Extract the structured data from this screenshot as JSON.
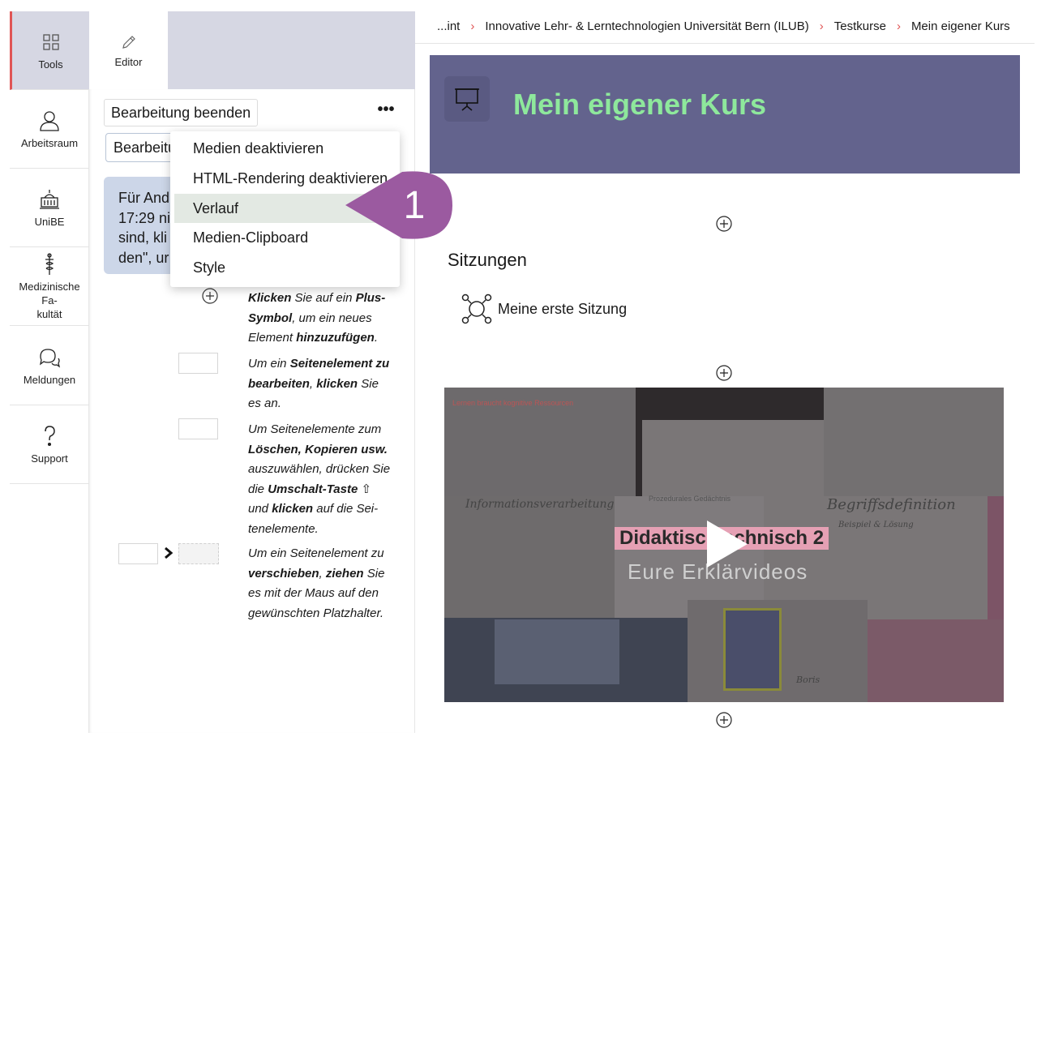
{
  "rail": {
    "items": [
      {
        "label": "Tools",
        "icon": "grid-icon"
      },
      {
        "label": "Arbeitsraum",
        "icon": "person-icon"
      },
      {
        "label": "UniBE",
        "icon": "building-icon"
      },
      {
        "label": "Medizinische Fa-\nkultät",
        "icon": "medical-icon"
      },
      {
        "label": "Meldungen",
        "icon": "chat-icon"
      },
      {
        "label": "Support",
        "icon": "question-icon"
      }
    ]
  },
  "tabs": {
    "editor": "Editor"
  },
  "editor": {
    "end_button": "Bearbeitung beenden",
    "more_button": "•••",
    "mode_select": "Bearbeitungsmodus",
    "info_lines": [
      "Für And",
      "17:29 ni",
      "sind, kli",
      "den\", ur"
    ],
    "help": {
      "add": {
        "t1": "Klicken",
        "t2": " Sie auf ein ",
        "t3": "Plus-Symbol",
        "t4": ", um ein neues Element ",
        "t5": "hinzuzufügen",
        "t6": "."
      },
      "edit": {
        "t1": "Um ein ",
        "t2": "Seitenelement zu bearbeiten",
        "t3": ", ",
        "t4": "klicken",
        "t5": " Sie es an."
      },
      "select": {
        "t1": "Um Seitenelemente zum ",
        "t2": "Löschen, Kopieren usw.",
        "t3": " auszuwählen, drücken Sie die ",
        "t4": "Umschalt-Taste",
        "t5": " ⇧ und ",
        "t6": "klicken",
        "t7": " auf die Sei­tenelemente."
      },
      "move": {
        "t1": "Um ein Seitenelement zu ",
        "t2": "verschieben",
        "t3": ", ",
        "t4": "ziehen",
        "t5": " Sie es mit der Maus auf den gewünschten Platzhalter."
      }
    }
  },
  "dropdown": {
    "items": [
      "Medien deaktivieren",
      "HTML-Rendering deaktivieren",
      "Verlauf",
      "Medien-Clipboard",
      "Style"
    ],
    "active_index": 2
  },
  "callout": {
    "number": "1",
    "color": "#9b5aa0"
  },
  "breadcrumb": [
    "...int",
    "Innovative Lehr- & Lerntechnologien Universität Bern (ILUB)",
    "Testkurse",
    "Mein eigener Kurs"
  ],
  "course": {
    "title": "Mein eigener Kurs",
    "banner_color": "#63638d",
    "title_color": "#8ee89c",
    "section_title": "Sitzungen",
    "session_label": "Meine erste Sitzung"
  },
  "video": {
    "title_text": "Didaktisch   echnisch 2",
    "subtitle": "Eure Erklärvideos",
    "top_label": "Lernen braucht kognitive Ressourcen",
    "mid_label": "Prozedurales Gedächtnis",
    "hand1": "Informationsverarbeitung",
    "hand2": "Begriffsdefinition",
    "hand3": "Beispiel & Lösung",
    "hand4": "Boris"
  }
}
